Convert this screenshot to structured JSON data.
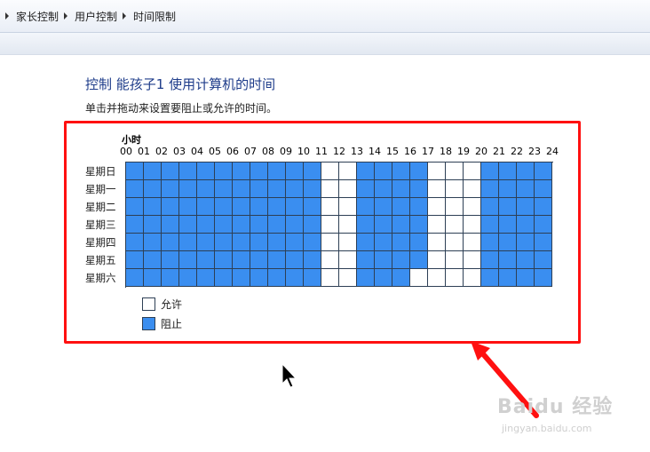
{
  "breadcrumb": [
    "家长控制",
    "用户控制",
    "时间限制"
  ],
  "page_title": "控制 能孩子1 使用计算机的时间",
  "instruction": "单击并拖动来设置要阻止或允许的时间。",
  "grid": {
    "hours_label": "小时",
    "hours": [
      "00",
      "01",
      "02",
      "03",
      "04",
      "05",
      "06",
      "07",
      "08",
      "09",
      "10",
      "11",
      "12",
      "13",
      "14",
      "15",
      "16",
      "17",
      "18",
      "19",
      "20",
      "21",
      "22",
      "23",
      "24"
    ],
    "days": [
      "星期日",
      "星期一",
      "星期二",
      "星期三",
      "星期四",
      "星期五",
      "星期六"
    ],
    "blocked_hours": [
      0,
      1,
      2,
      3,
      4,
      5,
      6,
      7,
      8,
      9,
      10,
      13,
      14,
      15,
      16,
      20,
      21,
      22,
      23
    ],
    "allowed_overrides": [
      {
        "day": 6,
        "hour": 16
      }
    ]
  },
  "legend": {
    "allow": "允许",
    "block": "阻止"
  },
  "colors": {
    "blocked": "#3a8ef0",
    "allowed": "#ffffff",
    "highlight": "#ff1010",
    "title": "#1e3c8a"
  },
  "watermark": {
    "text": "Baidu 经验",
    "sub": "jingyan.baidu.com"
  }
}
